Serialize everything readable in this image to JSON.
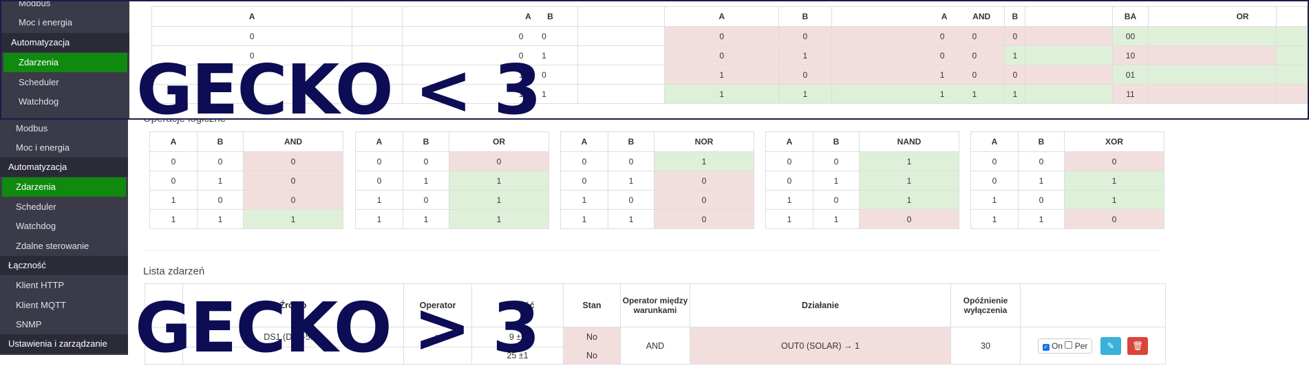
{
  "sidebar": {
    "items": [
      {
        "label": "Modbus",
        "type": "item"
      },
      {
        "label": "Moc i energia",
        "type": "item"
      },
      {
        "label": "Automatyzacja",
        "type": "section"
      },
      {
        "label": "Zdarzenia",
        "type": "active"
      },
      {
        "label": "Scheduler",
        "type": "item"
      },
      {
        "label": "Watchdog",
        "type": "item"
      },
      {
        "label": "Zdalne sterowanie",
        "type": "item"
      },
      {
        "label": "Łączność",
        "type": "section"
      },
      {
        "label": "Klient HTTP",
        "type": "item"
      },
      {
        "label": "Klient MQTT",
        "type": "item"
      },
      {
        "label": "SNMP",
        "type": "item"
      },
      {
        "label": "Ustawienia i zarządzanie",
        "type": "section"
      }
    ]
  },
  "overlay_sidebar": {
    "items": [
      {
        "label": "Modbus"
      },
      {
        "label": "Moc i energia"
      },
      {
        "label": "Automatyzacja"
      },
      {
        "label": "Zdarzenia"
      },
      {
        "label": "Scheduler"
      },
      {
        "label": "Watchdog"
      }
    ]
  },
  "overlay_captions": {
    "top": "GECKO < 3",
    "bottom": "GECKO > 3"
  },
  "logic": {
    "title": "Operacje logiczne",
    "tables": [
      {
        "headers": [
          "A",
          "B",
          "AND"
        ],
        "rows": [
          [
            "0",
            "0",
            "0"
          ],
          [
            "0",
            "1",
            "0"
          ],
          [
            "1",
            "0",
            "0"
          ],
          [
            "1",
            "1",
            "1"
          ]
        ],
        "res": [
          "red",
          "red",
          "red",
          "green"
        ]
      },
      {
        "headers": [
          "A",
          "B",
          "OR"
        ],
        "rows": [
          [
            "0",
            "0",
            "0"
          ],
          [
            "0",
            "1",
            "1"
          ],
          [
            "1",
            "0",
            "1"
          ],
          [
            "1",
            "1",
            "1"
          ]
        ],
        "res": [
          "red",
          "green",
          "green",
          "green"
        ]
      },
      {
        "headers": [
          "A",
          "B",
          "NOR"
        ],
        "rows": [
          [
            "0",
            "0",
            "1"
          ],
          [
            "0",
            "1",
            "0"
          ],
          [
            "1",
            "0",
            "0"
          ],
          [
            "1",
            "1",
            "0"
          ]
        ],
        "res": [
          "green",
          "red",
          "red",
          "red"
        ]
      },
      {
        "headers": [
          "A",
          "B",
          "NAND"
        ],
        "rows": [
          [
            "0",
            "0",
            "1"
          ],
          [
            "0",
            "1",
            "1"
          ],
          [
            "1",
            "0",
            "1"
          ],
          [
            "1",
            "1",
            "0"
          ]
        ],
        "res": [
          "green",
          "green",
          "green",
          "red"
        ]
      },
      {
        "headers": [
          "A",
          "B",
          "XOR"
        ],
        "rows": [
          [
            "0",
            "0",
            "0"
          ],
          [
            "0",
            "1",
            "1"
          ],
          [
            "1",
            "0",
            "1"
          ],
          [
            "1",
            "1",
            "0"
          ]
        ],
        "res": [
          "red",
          "green",
          "green",
          "red"
        ]
      }
    ]
  },
  "overlay_table": {
    "h1": "A",
    "h2": "A",
    "h3": "B",
    "h4": "A",
    "h5": "B",
    "h6": "A",
    "h7": "AND",
    "h8": "B",
    "h9": "BA",
    "h10": "OR",
    "rows": [
      {
        "a": "0",
        "ab_a": "0",
        "ab_b": "0",
        "c1": "0",
        "c2": "0",
        "c3": "0",
        "c4": "0",
        "c5": "0",
        "c6": "00"
      },
      {
        "a": "0",
        "ab_a": "0",
        "ab_b": "1",
        "c1": "0",
        "c2": "1",
        "c3": "0",
        "c4": "0",
        "c5": "1",
        "c6": "10"
      },
      {
        "a": "1",
        "ab_a": "1",
        "ab_b": "0",
        "c1": "1",
        "c2": "0",
        "c3": "1",
        "c4": "0",
        "c5": "0",
        "c6": "01"
      },
      {
        "a": "1",
        "ab_a": "1",
        "ab_b": "1",
        "c1": "1",
        "c2": "1",
        "c3": "1",
        "c4": "1",
        "c5": "1",
        "c6": "11"
      }
    ]
  },
  "events": {
    "title": "Lista zdarzeń",
    "headers": {
      "source": "Źródło",
      "operator": "Operator",
      "value": "Wartość",
      "state": "Stan",
      "between": "Operator między warunkami",
      "action": "Działanie",
      "delay": "Opóźnienie wyłączenia"
    },
    "row": {
      "source": "DS1 (DS2-551)",
      "operator": "≥",
      "value": "9 ±1",
      "state": "No",
      "between": "AND",
      "action": "OUT0 (SOLAR) → 1",
      "delay": "30",
      "on_label": "On",
      "per_label": "Per"
    },
    "row2": {
      "value": "25 ±1",
      "state": "No"
    }
  }
}
